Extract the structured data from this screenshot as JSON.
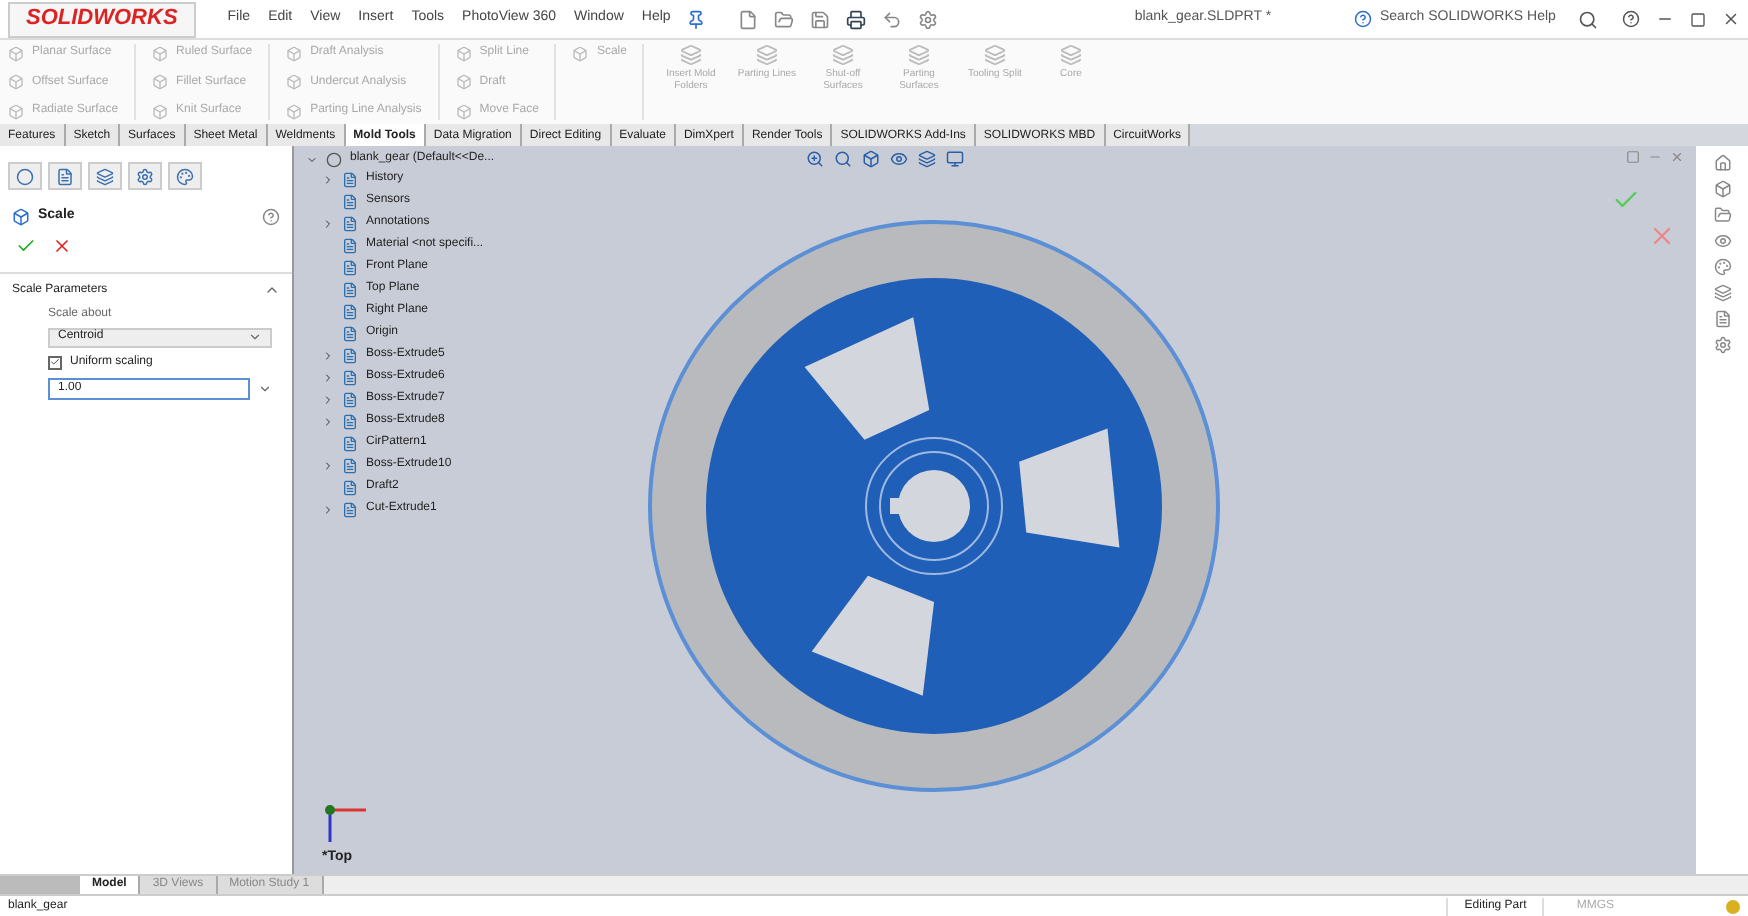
{
  "app": {
    "logo": "SOLIDWORKS",
    "menu": [
      "File",
      "Edit",
      "View",
      "Insert",
      "Tools",
      "PhotoView 360",
      "Window",
      "Help"
    ],
    "title": "blank_gear.SLDPRT *",
    "search": {
      "placeholder": "Search SOLIDWORKS Help"
    }
  },
  "ribbon": {
    "columns": [
      [
        "Planar Surface",
        "Offset Surface",
        "Radiate Surface"
      ],
      [
        "Ruled Surface",
        "Fillet Surface",
        "Knit Surface"
      ],
      [
        "Draft Analysis",
        "Undercut Analysis",
        "Parting Line Analysis"
      ],
      [
        "Split Line",
        "Draft",
        "Move Face"
      ],
      [
        "Scale"
      ]
    ],
    "big_buttons": [
      "Insert Mold Folders",
      "Parting Lines",
      "Shut-off Surfaces",
      "Parting Surfaces",
      "Tooling Split",
      "Core"
    ],
    "disabled": true
  },
  "tabs": [
    {
      "label": "Features",
      "selected": false
    },
    {
      "label": "Sketch",
      "selected": false
    },
    {
      "label": "Surfaces",
      "selected": false
    },
    {
      "label": "Sheet Metal",
      "selected": false
    },
    {
      "label": "Weldments",
      "selected": false
    },
    {
      "label": "Mold Tools",
      "selected": true
    },
    {
      "label": "Data Migration",
      "selected": false
    },
    {
      "label": "Direct Editing",
      "selected": false
    },
    {
      "label": "Evaluate",
      "selected": false
    },
    {
      "label": "DimXpert",
      "selected": false
    },
    {
      "label": "Render Tools",
      "selected": false
    },
    {
      "label": "SOLIDWORKS Add-Ins",
      "selected": false
    },
    {
      "label": "SOLIDWORKS MBD",
      "selected": false
    },
    {
      "label": "CircuitWorks",
      "selected": false
    }
  ],
  "property_manager": {
    "title": "Scale",
    "section": "Scale Parameters",
    "scale_about_label": "Scale about",
    "scale_about": "Centroid",
    "uniform_scaling": {
      "label": "Uniform scaling",
      "checked": true
    },
    "factor": "1.00"
  },
  "tree": {
    "label": "blank_gear  (Default<<De...",
    "children": [
      {
        "label": "History",
        "expandable": true
      },
      {
        "label": "Sensors",
        "expandable": false
      },
      {
        "label": "Annotations",
        "expandable": true
      },
      {
        "label": "Material <not specifi...",
        "expandable": false
      },
      {
        "label": "Front Plane",
        "expandable": false
      },
      {
        "label": "Top Plane",
        "expandable": false
      },
      {
        "label": "Right Plane",
        "expandable": false
      },
      {
        "label": "Origin",
        "expandable": false
      },
      {
        "label": "Boss-Extrude5",
        "expandable": true
      },
      {
        "label": "Boss-Extrude6",
        "expandable": true
      },
      {
        "label": "Boss-Extrude7",
        "expandable": true
      },
      {
        "label": "Boss-Extrude8",
        "expandable": true
      },
      {
        "label": "CirPattern1",
        "expandable": false
      },
      {
        "label": "Boss-Extrude10",
        "expandable": true
      },
      {
        "label": "Draft2",
        "expandable": false
      },
      {
        "label": "Cut-Extrude1",
        "expandable": true
      }
    ]
  },
  "viewport": {
    "orientation": "*Top"
  },
  "bottom_tabs": [
    {
      "label": "Model",
      "selected": true
    },
    {
      "label": "3D Views",
      "selected": false
    },
    {
      "label": "Motion Study 1",
      "selected": false
    }
  ],
  "status_bar": {
    "document": "blank_gear",
    "mode": "Editing Part",
    "units": "MMGS"
  }
}
